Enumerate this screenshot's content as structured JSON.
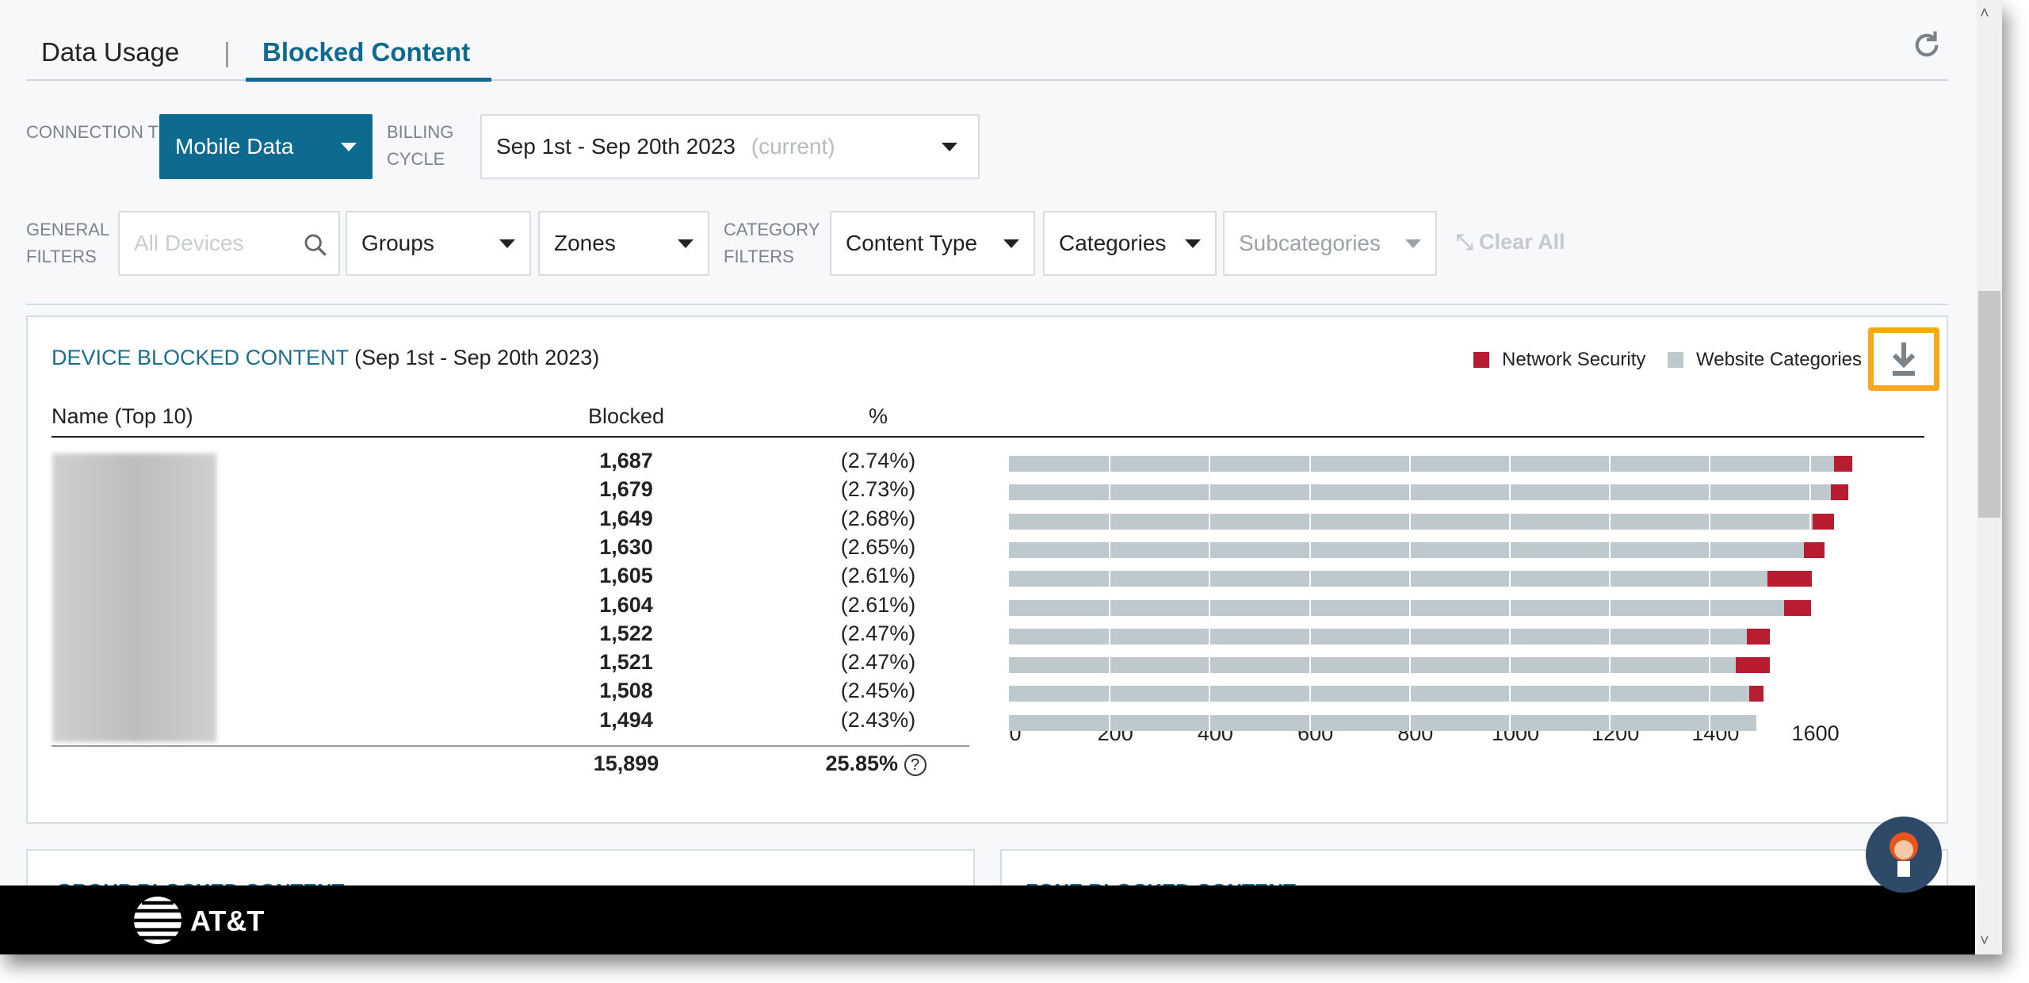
{
  "tabs": [
    {
      "label": "Data Usage",
      "active": false
    },
    {
      "label": "Blocked Content",
      "active": true
    }
  ],
  "tab_separator": "|",
  "refresh_icon": "refresh-icon",
  "filters": {
    "connection_label": "CONNECTION TYPE FILTER",
    "connection_value": "Mobile Data",
    "billing_label": "BILLING CYCLE",
    "billing_value": "Sep 1st - Sep 20th 2023",
    "billing_note": "(current)",
    "general_label": "GENERAL FILTERS",
    "devices_placeholder": "All Devices",
    "groups": "Groups",
    "zones": "Zones",
    "category_label": "CATEGORY FILTERS",
    "content_type": "Content Type",
    "categories": "Categories",
    "subcategories": "Subcategories",
    "clear_all": "Clear All"
  },
  "card": {
    "title": "DEVICE BLOCKED CONTENT",
    "subtitle": "(Sep 1st - Sep 20th 2023)",
    "col_name": "Name (Top 10)",
    "col_blocked": "Blocked",
    "col_pct": "%",
    "total_blocked": "15,899",
    "total_pct": "25.85%",
    "rows": [
      {
        "blocked": "1,687",
        "pct": "(2.74%)"
      },
      {
        "blocked": "1,679",
        "pct": "(2.73%)"
      },
      {
        "blocked": "1,649",
        "pct": "(2.68%)"
      },
      {
        "blocked": "1,630",
        "pct": "(2.65%)"
      },
      {
        "blocked": "1,605",
        "pct": "(2.61%)"
      },
      {
        "blocked": "1,604",
        "pct": "(2.61%)"
      },
      {
        "blocked": "1,522",
        "pct": "(2.47%)"
      },
      {
        "blocked": "1,521",
        "pct": "(2.47%)"
      },
      {
        "blocked": "1,508",
        "pct": "(2.45%)"
      },
      {
        "blocked": "1,494",
        "pct": "(2.43%)"
      }
    ]
  },
  "chart_data": {
    "type": "bar",
    "orientation": "horizontal",
    "stacked": true,
    "xlim": [
      0,
      1600
    ],
    "ticks": [
      0,
      200,
      400,
      600,
      800,
      1000,
      1200,
      1400,
      1600
    ],
    "legend_position": "top-right",
    "series": [
      {
        "name": "Website Categories",
        "color": "#bec9cd",
        "values": [
          1650,
          1643,
          1607,
          1590,
          1517,
          1550,
          1475,
          1453,
          1480,
          1494
        ]
      },
      {
        "name": "Network Security",
        "color": "#b81c30",
        "values": [
          37,
          36,
          42,
          40,
          88,
          54,
          47,
          68,
          28,
          0
        ]
      }
    ]
  },
  "bottom_cards": [
    "GROUP BLOCKED CONTENT",
    "ZONE BLOCKED CONTENT"
  ],
  "footer": {
    "brand": "AT&T"
  },
  "colors": {
    "accent": "#0e6a8e",
    "highlight": "#f9a81a"
  }
}
